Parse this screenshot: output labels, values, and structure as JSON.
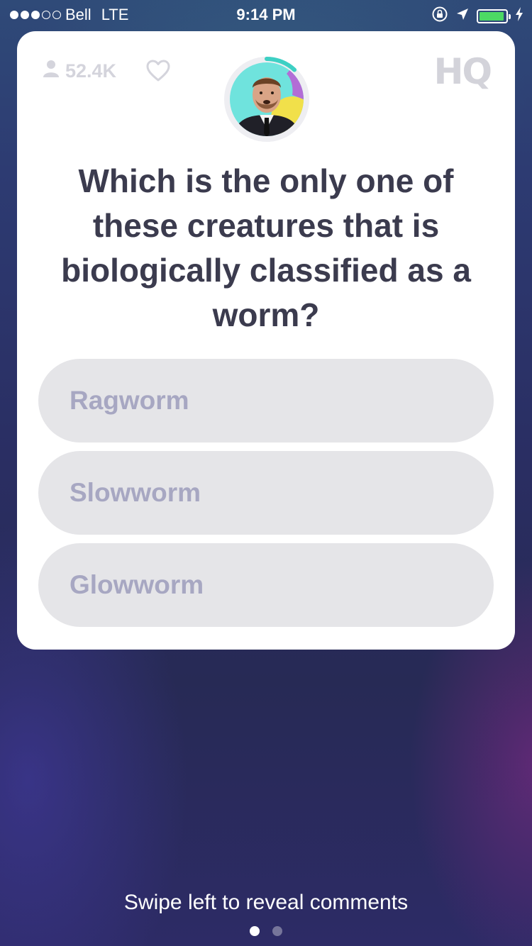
{
  "status_bar": {
    "signal_full": 3,
    "signal_total": 5,
    "carrier": "Bell",
    "network": "LTE",
    "time": "9:14 PM",
    "battery_level": 0.95,
    "icons": [
      "orientation-lock-icon",
      "location-arrow-icon",
      "battery-icon",
      "charging-bolt-icon"
    ]
  },
  "header": {
    "viewer_count": "52.4K",
    "viewer_icon": "person-icon",
    "heart_icon": "heart-icon",
    "logo": "HQ",
    "timer_remaining": 0.12,
    "timer_color": "#3dd0c4"
  },
  "question": {
    "text": "Which is the only one of these creatures that is biologically classified as a worm?"
  },
  "answers": [
    {
      "label": "Ragworm"
    },
    {
      "label": "Slowworm"
    },
    {
      "label": "Glowworm"
    }
  ],
  "footer": {
    "hint": "Swipe left to reveal comments",
    "page_count": 2,
    "active_page": 1
  },
  "colors": {
    "card": "#ffffff",
    "question_text": "#3b3b4e",
    "answer_bg": "#e5e5e8",
    "answer_text": "#a7a7c2",
    "battery": "#4cd964"
  }
}
